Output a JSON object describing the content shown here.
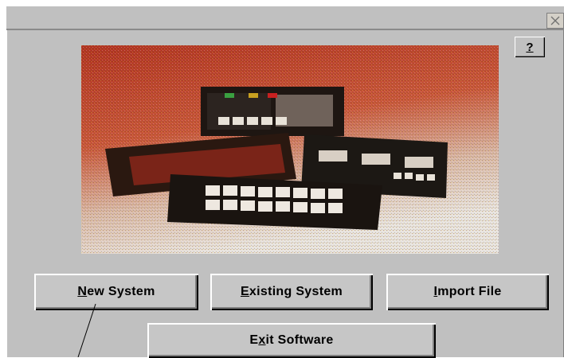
{
  "dialog": {
    "help_label": "?",
    "buttons": {
      "new_system": {
        "pre": "",
        "mnemonic": "N",
        "post": "ew System"
      },
      "existing_system": {
        "pre": "",
        "mnemonic": "E",
        "post": "xisting System"
      },
      "import_file": {
        "pre": "",
        "mnemonic": "I",
        "post": "mport File"
      },
      "exit_software": {
        "pre": "E",
        "mnemonic": "x",
        "post": "it Software"
      }
    }
  },
  "icons": {
    "close": "close-icon",
    "help": "help-icon",
    "photo": "product-photo"
  },
  "colors": {
    "dialog_bg": "#c0c0c0",
    "photo_bg": "#c24028"
  }
}
